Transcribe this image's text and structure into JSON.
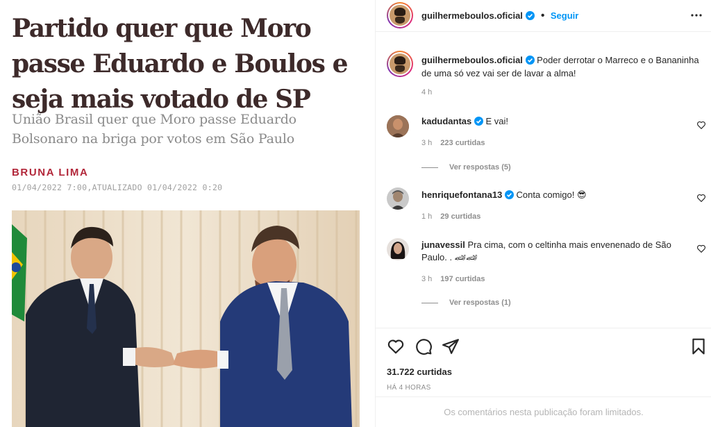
{
  "article": {
    "headline": "Partido quer que Moro passe Eduardo e Boulos e seja mais votado de SP",
    "subheadline": "União Brasil quer que Moro passe Eduardo Bolsonaro na briga por votos em São Paulo",
    "author": "BRUNA LIMA",
    "dateline": "01/04/2022 7:00,ATUALIZADO 01/04/2022 0:20"
  },
  "instagram": {
    "header": {
      "username": "guilhermeboulos.oficial",
      "follow_label": "Seguir",
      "separator": "•"
    },
    "caption": {
      "username": "guilhermeboulos.oficial",
      "text": "Poder derrotar o Marreco e o Bananinha de uma só vez vai ser de lavar a alma!",
      "time": "4 h"
    },
    "comments": [
      {
        "username": "kadudantas",
        "verified": true,
        "text": "E vai!",
        "time": "3 h",
        "likes": "223 curtidas",
        "replies": "Ver respostas (5)"
      },
      {
        "username": "henriquefontana13",
        "verified": true,
        "text": "Conta comigo! 😎",
        "time": "1 h",
        "likes": "29 curtidas",
        "replies": ""
      },
      {
        "username": "junavessil",
        "verified": false,
        "text": "Pra cima, com o celtinha mais envenenado de São Paulo. . 🏎🏎",
        "time": "3 h",
        "likes": "197 curtidas",
        "replies": "Ver respostas (1)"
      }
    ],
    "likes": "31.722 curtidas",
    "posted_ago": "HÁ 4 HORAS",
    "limited_notice": "Os comentários nesta publicação foram limitados.",
    "accent_color": "#0095f6"
  },
  "colors": {
    "headline": "#3d2a2a",
    "author": "#b2273a",
    "subheadline": "#8a8a8a"
  }
}
